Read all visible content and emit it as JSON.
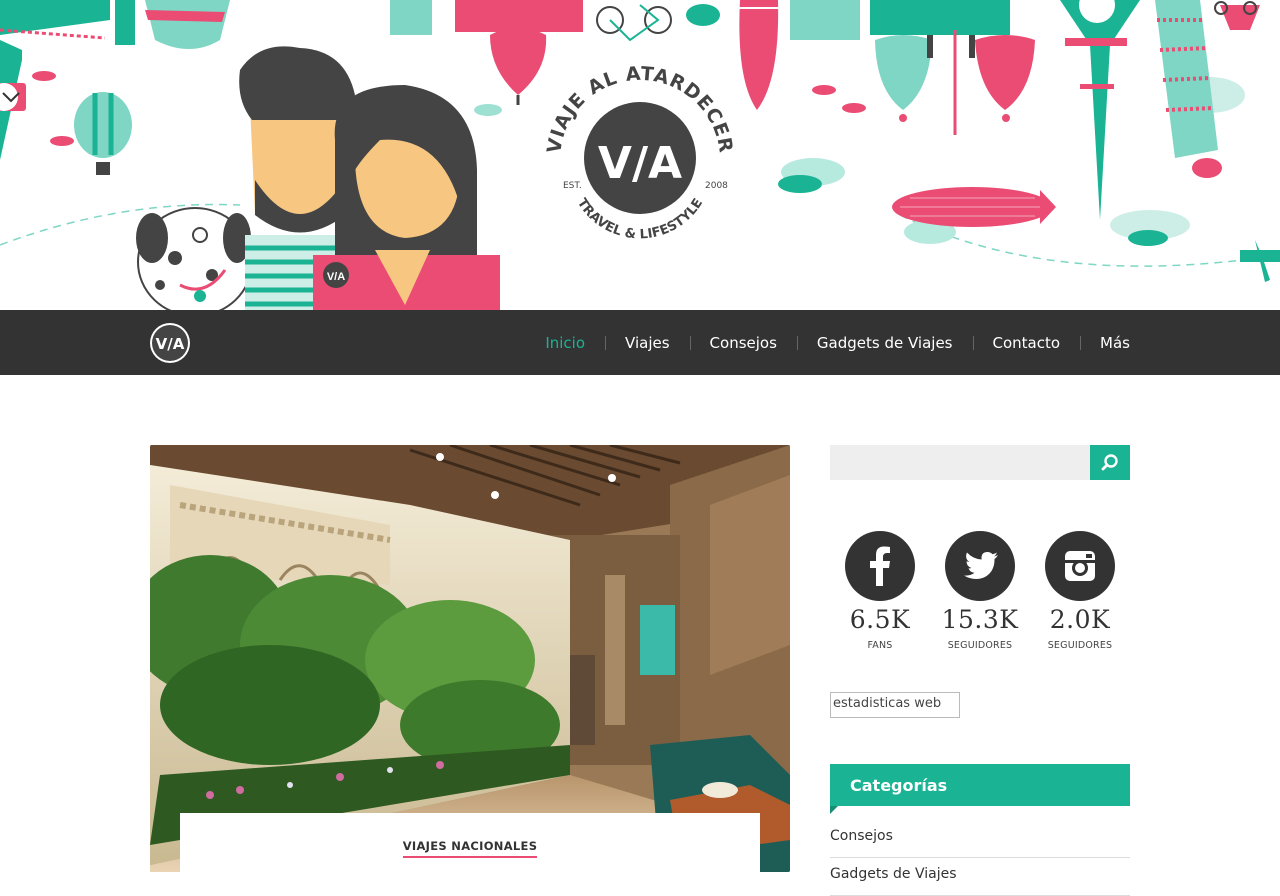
{
  "hero": {
    "logo_top_text": "VIAJE AL ATARDECER",
    "logo_mark": "V/A",
    "logo_est": "EST.",
    "logo_year": "2008",
    "logo_bottom_text": "TRAVEL & LIFESTYLE",
    "badge_text": "V/A"
  },
  "nav": {
    "logo_text": "V/A",
    "items": [
      {
        "label": "Inicio"
      },
      {
        "label": "Viajes"
      },
      {
        "label": "Consejos"
      },
      {
        "label": "Gadgets de Viajes"
      },
      {
        "label": "Contacto"
      },
      {
        "label": "Más"
      }
    ]
  },
  "post": {
    "category": "VIAJES NACIONALES"
  },
  "search": {
    "placeholder": "",
    "value": ""
  },
  "social": [
    {
      "icon": "facebook-icon",
      "count": "6.5K",
      "label": "FANS"
    },
    {
      "icon": "twitter-icon",
      "count": "15.3K",
      "label": "SEGUIDORES"
    },
    {
      "icon": "instagram-icon",
      "count": "2.0K",
      "label": "SEGUIDORES"
    }
  ],
  "stats_alt": "estadisticas web",
  "categories": {
    "title": "Categorías",
    "items": [
      {
        "label": "Consejos"
      },
      {
        "label": "Gadgets de Viajes"
      }
    ]
  },
  "colors": {
    "accent": "#1ab394",
    "pink": "#ea4c73",
    "nav_bg": "#333333",
    "skin": "#f7c782"
  }
}
